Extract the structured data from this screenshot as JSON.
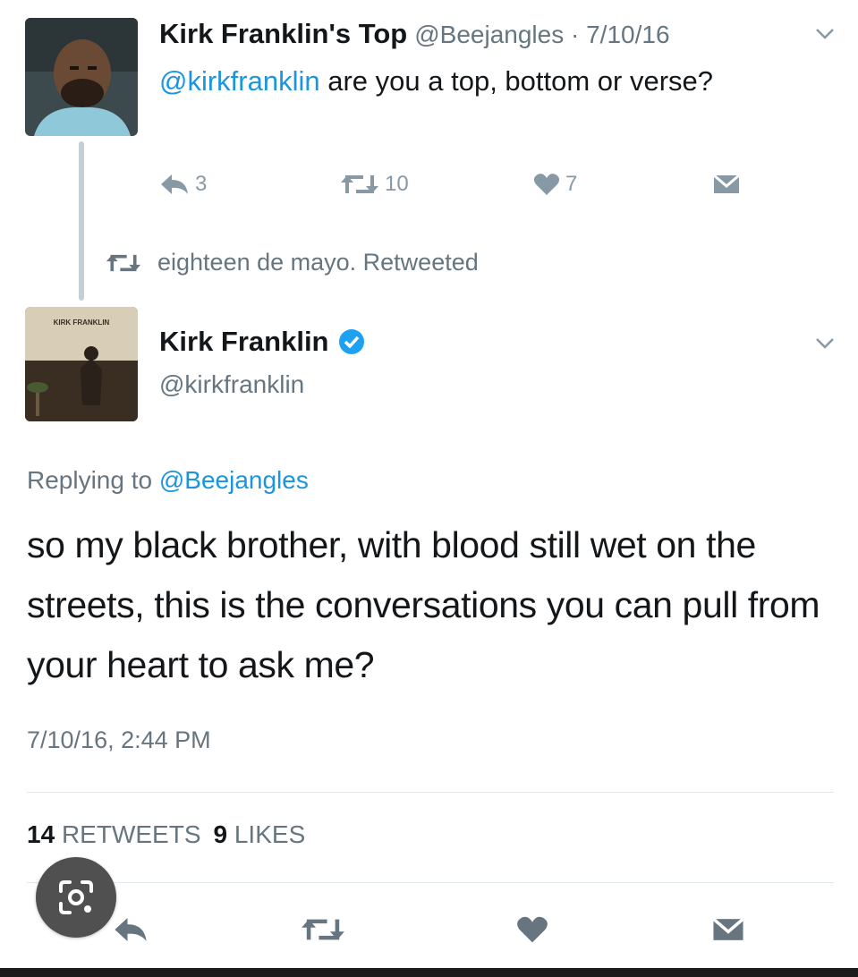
{
  "colors": {
    "link": "#1b95e0",
    "muted": "#66757f",
    "icon": "#8899a6",
    "verified": "#1da1f2",
    "lens_button": "#505050"
  },
  "tweet1": {
    "display_name": "Kirk Franklin's Top",
    "meta": "@Beejangles · 7/10/16",
    "mention": "@kirkfranklin",
    "text": " are you a top, bottom or verse?",
    "actions": {
      "reply_count": "3",
      "retweet_count": "10",
      "like_count": "7"
    },
    "avatar_icon": "user-photo"
  },
  "retweet_context": {
    "text": "eighteen de mayo. Retweeted"
  },
  "tweet2": {
    "display_name": "Kirk Franklin",
    "handle": "@kirkfranklin",
    "replying_prefix": "Replying to ",
    "replying_to": "@Beejangles",
    "text": "so my black brother, with blood still wet on the streets, this is the conversations you can pull from your heart to ask me?",
    "timestamp": "7/10/16, 2:44 PM",
    "stats": {
      "retweets": "14",
      "retweets_label": "RETWEETS",
      "likes": "9",
      "likes_label": "LIKES"
    },
    "avatar_icon": "album-cover",
    "avatar_text": "KIRK FRANKLIN"
  },
  "icons": [
    "reply-icon",
    "retweet-icon",
    "heart-icon",
    "direct-message-icon",
    "chevron-down-icon",
    "verified-badge-icon",
    "lens-search-icon"
  ]
}
